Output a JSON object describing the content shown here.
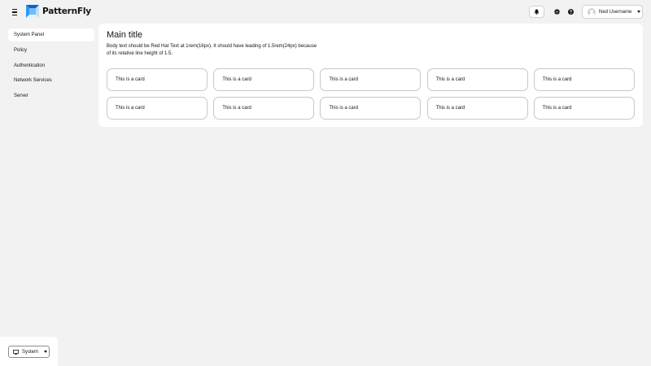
{
  "masthead": {
    "brand": "PatternFly",
    "user_name": "Ned Username",
    "icons": [
      "menu-icon",
      "bell-icon",
      "gear-icon",
      "help-icon",
      "user-avatar",
      "caret-down-icon"
    ]
  },
  "sidebar": {
    "items": [
      {
        "label": "System Panel",
        "current": true
      },
      {
        "label": "Policy"
      },
      {
        "label": "Authentication"
      },
      {
        "label": "Network Services"
      },
      {
        "label": "Server"
      }
    ],
    "footer_select": "System"
  },
  "main": {
    "title": "Main title",
    "body": "Body text should be Red Hat Text at 1rem(16px). It should have leading of 1.5rem(24px) because of its relative line height of 1.5.",
    "cards": [
      "This is a card",
      "This is a card",
      "This is a card",
      "This is a card",
      "This is a card",
      "This is a card",
      "This is a card",
      "This is a card",
      "This is a card",
      "This is a card"
    ]
  },
  "colors": {
    "background": "#f2f2f2",
    "panel": "#ffffff",
    "border": "#c7c7c7",
    "logo_blue": "#2b9af3",
    "logo_dark": "#0066cc"
  }
}
